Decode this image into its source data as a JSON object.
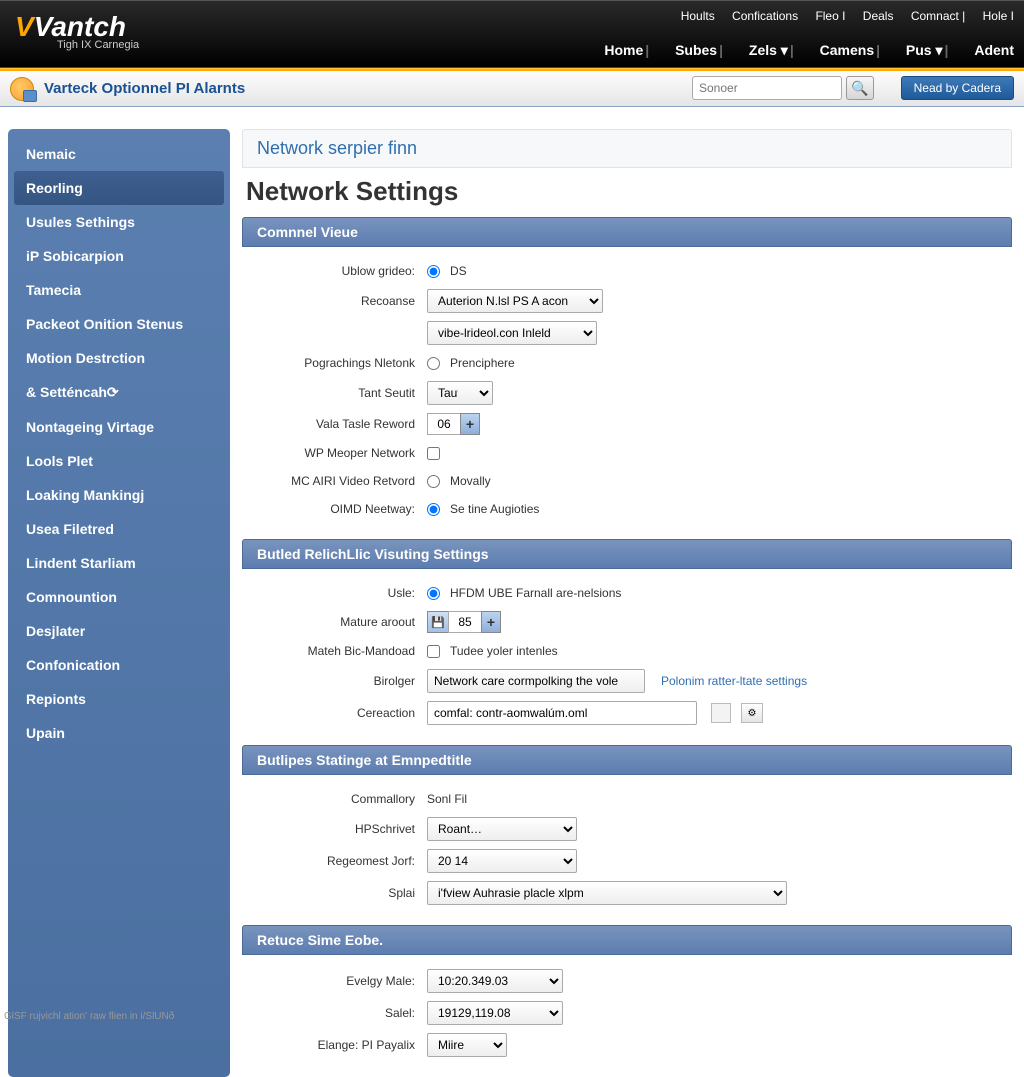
{
  "header": {
    "logo_main": "Vantch",
    "logo_sub": "Tigh IX Carnegia",
    "top_links": [
      "Hoults",
      "Confications",
      "Fleo I",
      "Deals",
      "Comnact |",
      "Hole I"
    ],
    "nav": [
      "Home",
      "Subes",
      "Zels ▾",
      "Camens",
      "Pus ▾",
      "Adent"
    ]
  },
  "subheader": {
    "title": "Varteck Optionnel PI Alarnts",
    "search_placeholder": "Sonoer",
    "cta": "Nead by Cadera"
  },
  "sidebar": {
    "items": [
      "Nemaic",
      "Reorling",
      "Usules Sethings",
      "iP Sobicarpion",
      "Tamecia",
      "Packeot Onition Stenus",
      "Motion Destrction",
      "& Setténcah⟳",
      "Nontageing Virtage",
      "Lools Plet",
      "Loaking Mankingj",
      "Usea Filetred",
      "Lindent Starliam",
      "Comnountion",
      "Desjlater",
      "Confonication",
      "Repionts",
      "Upain"
    ],
    "active_index": 1
  },
  "breadcrumb": "Network serpier finn",
  "page_title": "Network Settings",
  "sections": {
    "s1": {
      "title": "Comnnel Vieue",
      "rows": {
        "r1": {
          "label": "Ublow grideo:",
          "value": "DS"
        },
        "r2": {
          "label": "Recoanse",
          "value": "Auterion N.lsl PS A acon.."
        },
        "r2b": {
          "value": "vibe-lrideol.con Inleld"
        },
        "r3": {
          "label": "Pograchings Nletonk",
          "value": "Prenciphere"
        },
        "r4": {
          "label": "Tant Seutit",
          "value": "Taut"
        },
        "r5": {
          "label": "Vala Tasle Reword",
          "value": "06"
        },
        "r6": {
          "label": "WP Meoper Network"
        },
        "r7": {
          "label": "MC AIRI Video Retvord",
          "value": "Movally"
        },
        "r8": {
          "label": "OIMD Neetway:",
          "value": "Se tine Augioties"
        }
      }
    },
    "s2": {
      "title": "Butled RelichLlic Visuting Settings",
      "rows": {
        "r1": {
          "label": "Usle:",
          "value": "HFDM UBE Farnall are-nelsions"
        },
        "r2": {
          "label": "Mature aroout",
          "value": "85"
        },
        "r3": {
          "label": "Mateh Bic-Mandoad",
          "value": "Tudee yoler intenles"
        },
        "r4": {
          "label": "Birolger",
          "value": "Network care cormpolking the vole",
          "aux": "Polonim ratter-ltate settings"
        },
        "r5": {
          "label": "Cereaction",
          "value": "comfal: contr-aomwalúm.oml"
        }
      }
    },
    "s3": {
      "title": "Butlipes Statinge at Emnpedtitle",
      "rows": {
        "r1": {
          "label": "Commallory",
          "value": "Sonl Fil"
        },
        "r2": {
          "label": "HPSchrivet",
          "value": "Roant…"
        },
        "r3": {
          "label": "Regeomest Jorf:",
          "value": "20 14"
        },
        "r4": {
          "label": "Splai",
          "value": "i'fview Auhrasie placle xlpm"
        }
      }
    },
    "s4": {
      "title": "Retuce Sime Eobe.",
      "rows": {
        "r1": {
          "label": "Evelgy Male:",
          "value": "10:20.349.03"
        },
        "r2": {
          "label": "Salel:",
          "value": "19129,119.08"
        },
        "r3": {
          "label": "Elange: PI Payalix",
          "value": "Miire"
        }
      }
    }
  },
  "footer": "GlSF rujvichl ation' raw flien in i/SlUNð"
}
